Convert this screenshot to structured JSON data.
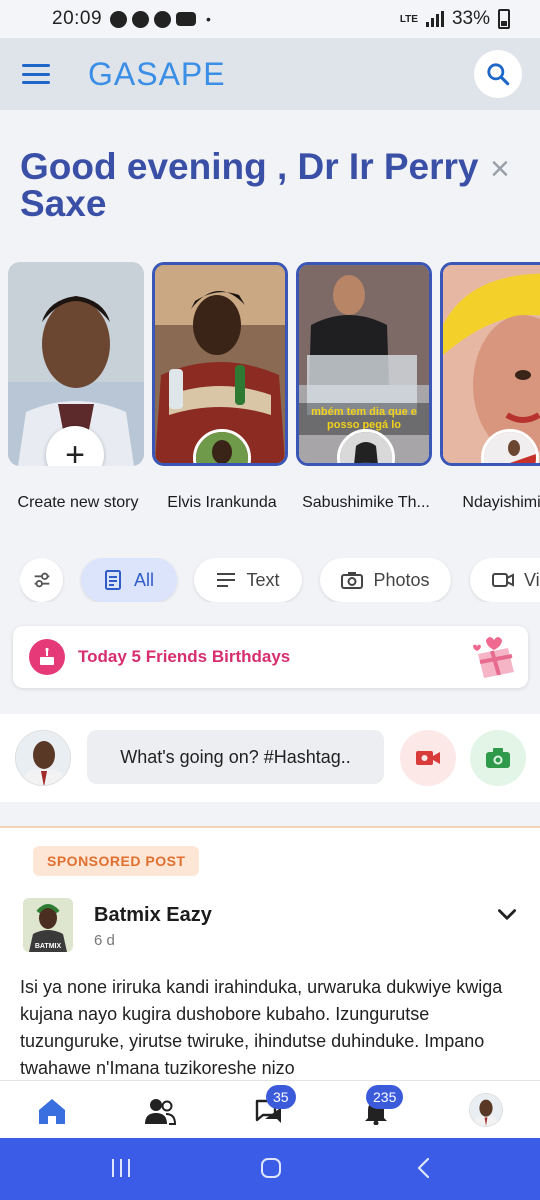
{
  "status_bar": {
    "time": "20:09",
    "network": "LTE",
    "battery": "33%"
  },
  "app_bar": {
    "brand": "GASAPE"
  },
  "greeting": {
    "text": "Good evening , Dr Ir Perry Saxe",
    "dismiss": "×"
  },
  "stories": [
    {
      "label": "Create new story",
      "create_symbol": "+"
    },
    {
      "label": "Elvis Irankunda"
    },
    {
      "label": "Sabushimike Th...",
      "caption_line1": "mbém tem dia que e",
      "caption_line2": "posso pegá lo"
    },
    {
      "label": "Ndayishimiye"
    }
  ],
  "filters": [
    {
      "label": "All",
      "active": true
    },
    {
      "label": "Text"
    },
    {
      "label": "Photos"
    },
    {
      "label": "Vi"
    }
  ],
  "birthday": {
    "text": "Today 5 Friends Birthdays"
  },
  "composer": {
    "placeholder": "What's going on? #Hashtag.."
  },
  "post": {
    "tag": "SPONSORED POST",
    "author": "Batmix Eazy",
    "avatar_text": "BATMIX",
    "time": "6 d",
    "body": "Isi ya none iriruka kandi irahinduka, urwaruka dukwiye kwiga kujana nayo kugira dushobore kubaho. Izungurutse tuzunguruke, yirutse twiruke, ihindutse duhinduke. Impano twahawe n'Imana tuzikoreshe nizo"
  },
  "bottom_nav": {
    "messages_badge": "35",
    "notifications_badge": "235"
  },
  "colors": {
    "accent": "#3a57b8",
    "brand": "#3a8ee6",
    "birthday": "#d62e6f",
    "sponsored": "#e07030",
    "system_nav": "#3b5ce6"
  }
}
